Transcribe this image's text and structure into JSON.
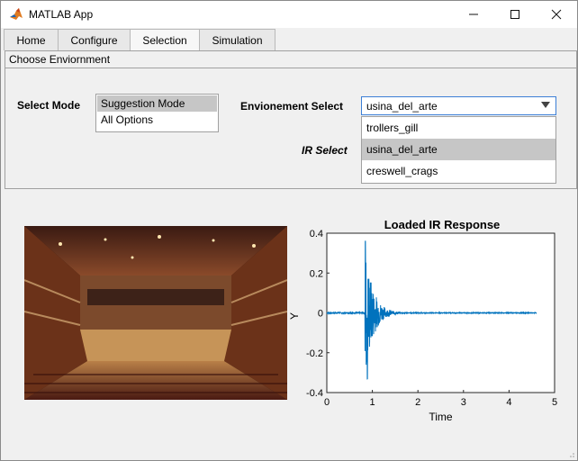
{
  "window": {
    "title": "MATLAB App",
    "icons": [
      "matlab-logo-icon",
      "minimize-icon",
      "maximize-icon",
      "close-icon"
    ]
  },
  "tabs": [
    {
      "label": "Home"
    },
    {
      "label": "Configure"
    },
    {
      "label": "Selection"
    },
    {
      "label": "Simulation"
    }
  ],
  "active_tab": "Selection",
  "panel": {
    "title": "Choose Enviornment",
    "select_mode_label": "Select Mode",
    "mode_options": [
      "Suggestion Mode",
      "All Options"
    ],
    "mode_selected": "Suggestion Mode",
    "env_select_label": "Envionement Select",
    "env_value": "usina_del_arte",
    "env_options": [
      "trollers_gill",
      "usina_del_arte",
      "creswell_crags"
    ],
    "ir_select_label": "IR Select"
  },
  "image": {
    "description": "concert-hall-photo"
  },
  "chart_data": {
    "type": "line",
    "title": "Loaded IR Response",
    "xlabel": "Time",
    "ylabel": "Y",
    "xlim": [
      0,
      5
    ],
    "ylim": [
      -0.4,
      0.4
    ],
    "xticks": [
      "0",
      "1",
      "2",
      "3",
      "4",
      "5"
    ],
    "yticks": [
      "0.4",
      "0.2",
      "0",
      "-0.2",
      "-0.4"
    ],
    "series_color": "#0072bd",
    "signal": {
      "onset": 0.84,
      "end": 4.6,
      "peak_max": 0.36,
      "peak_min": -0.33,
      "decay_by": 1.6
    }
  }
}
